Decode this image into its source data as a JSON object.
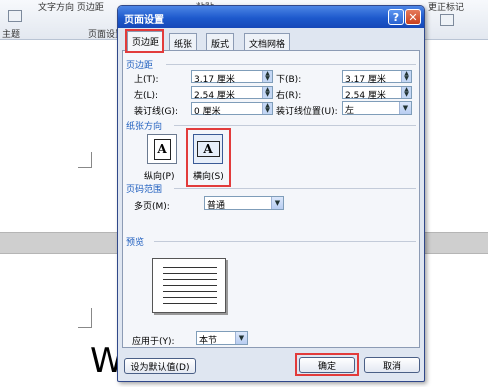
{
  "background": {
    "ribbon_text_1": "文字方向 页边距",
    "ribbon_text_2": "粘贴",
    "ribbon_text_3": "更正标记",
    "ribbon_group_left": "主题",
    "ribbon_group_page": "页面设置",
    "doc_letter": "W"
  },
  "dialog": {
    "title": "页面设置",
    "help_glyph": "?",
    "close_glyph": "✕",
    "tabs": [
      "页边距",
      "纸张",
      "版式",
      "文档网格"
    ],
    "margins": {
      "section": "页边距",
      "top_label": "上(T):",
      "top_value": "3.17 厘米",
      "bottom_label": "下(B):",
      "bottom_value": "3.17 厘米",
      "left_label": "左(L):",
      "left_value": "2.54 厘米",
      "right_label": "右(R):",
      "right_value": "2.54 厘米",
      "gutter_label": "装订线(G):",
      "gutter_value": "0 厘米",
      "gutter_pos_label": "装订线位置(U):",
      "gutter_pos_value": "左"
    },
    "orientation": {
      "section": "纸张方向",
      "portrait_label": "纵向(P)",
      "landscape_label": "横向(S)",
      "glyph": "A",
      "selected": "landscape"
    },
    "pages": {
      "section": "页码范围",
      "multi_label": "多页(M):",
      "multi_value": "普通"
    },
    "preview": {
      "section": "预览",
      "apply_label": "应用于(Y):",
      "apply_value": "本节"
    },
    "buttons": {
      "default": "设为默认值(D)",
      "ok": "确定",
      "cancel": "取消"
    },
    "colors": {
      "title_bar": "#1d59cc",
      "highlight": "#e23b3b",
      "section_text": "#1f5fbf"
    }
  }
}
